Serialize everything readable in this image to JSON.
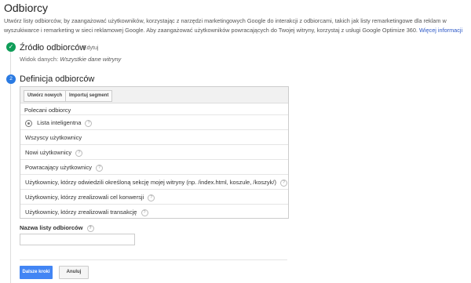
{
  "page": {
    "title": "Odbiorcy",
    "description": "Utwórz listy odbiorców, by zaangażować użytkowników, korzystając z narzędzi marketingowych Google do interakcji z odbiorcami, takich jak listy remarketingowe dla reklam w wyszukiwarce i remarketing w sieci reklamowej Google. Aby zaangażować użytkowników powracających do Twojej witryny, korzystaj z usługi Google Optimize 360.",
    "learn_more": "Więcej informacji"
  },
  "step1": {
    "title": "Źródło odbiorców",
    "edit": "Edytuj",
    "view_label": "Widok danych:",
    "view_value": "Wszystkie dane witryny"
  },
  "step2": {
    "number": "2",
    "title": "Definicja odbiorców",
    "create_new": "Utwórz nowych",
    "import_segment": "Importuj segment",
    "suggested": "Polecani odbiorcy",
    "audiences": [
      "Lista inteligentna",
      "Wszyscy użytkownicy",
      "Nowi użytkownicy",
      "Powracający użytkownicy",
      "Użytkownicy, którzy odwiedzili określoną sekcję mojej witryny (np. /index.html, koszule, /koszyk/)",
      "Użytkownicy, którzy zrealizowali cel konwersji",
      "Użytkownicy, którzy zrealizowali transakcję"
    ]
  },
  "form": {
    "name_label": "Nazwa listy odbiorców",
    "name_value": ""
  },
  "actions": {
    "next": "Dalsze kroki",
    "cancel": "Anuluj"
  },
  "colors": {
    "accent": "#4285f4",
    "success": "#0f9d58",
    "link": "#2a56c6"
  },
  "icons": {
    "step1": "check-circle-icon",
    "smart_list": "smart-list-icon",
    "help": "help-icon"
  }
}
